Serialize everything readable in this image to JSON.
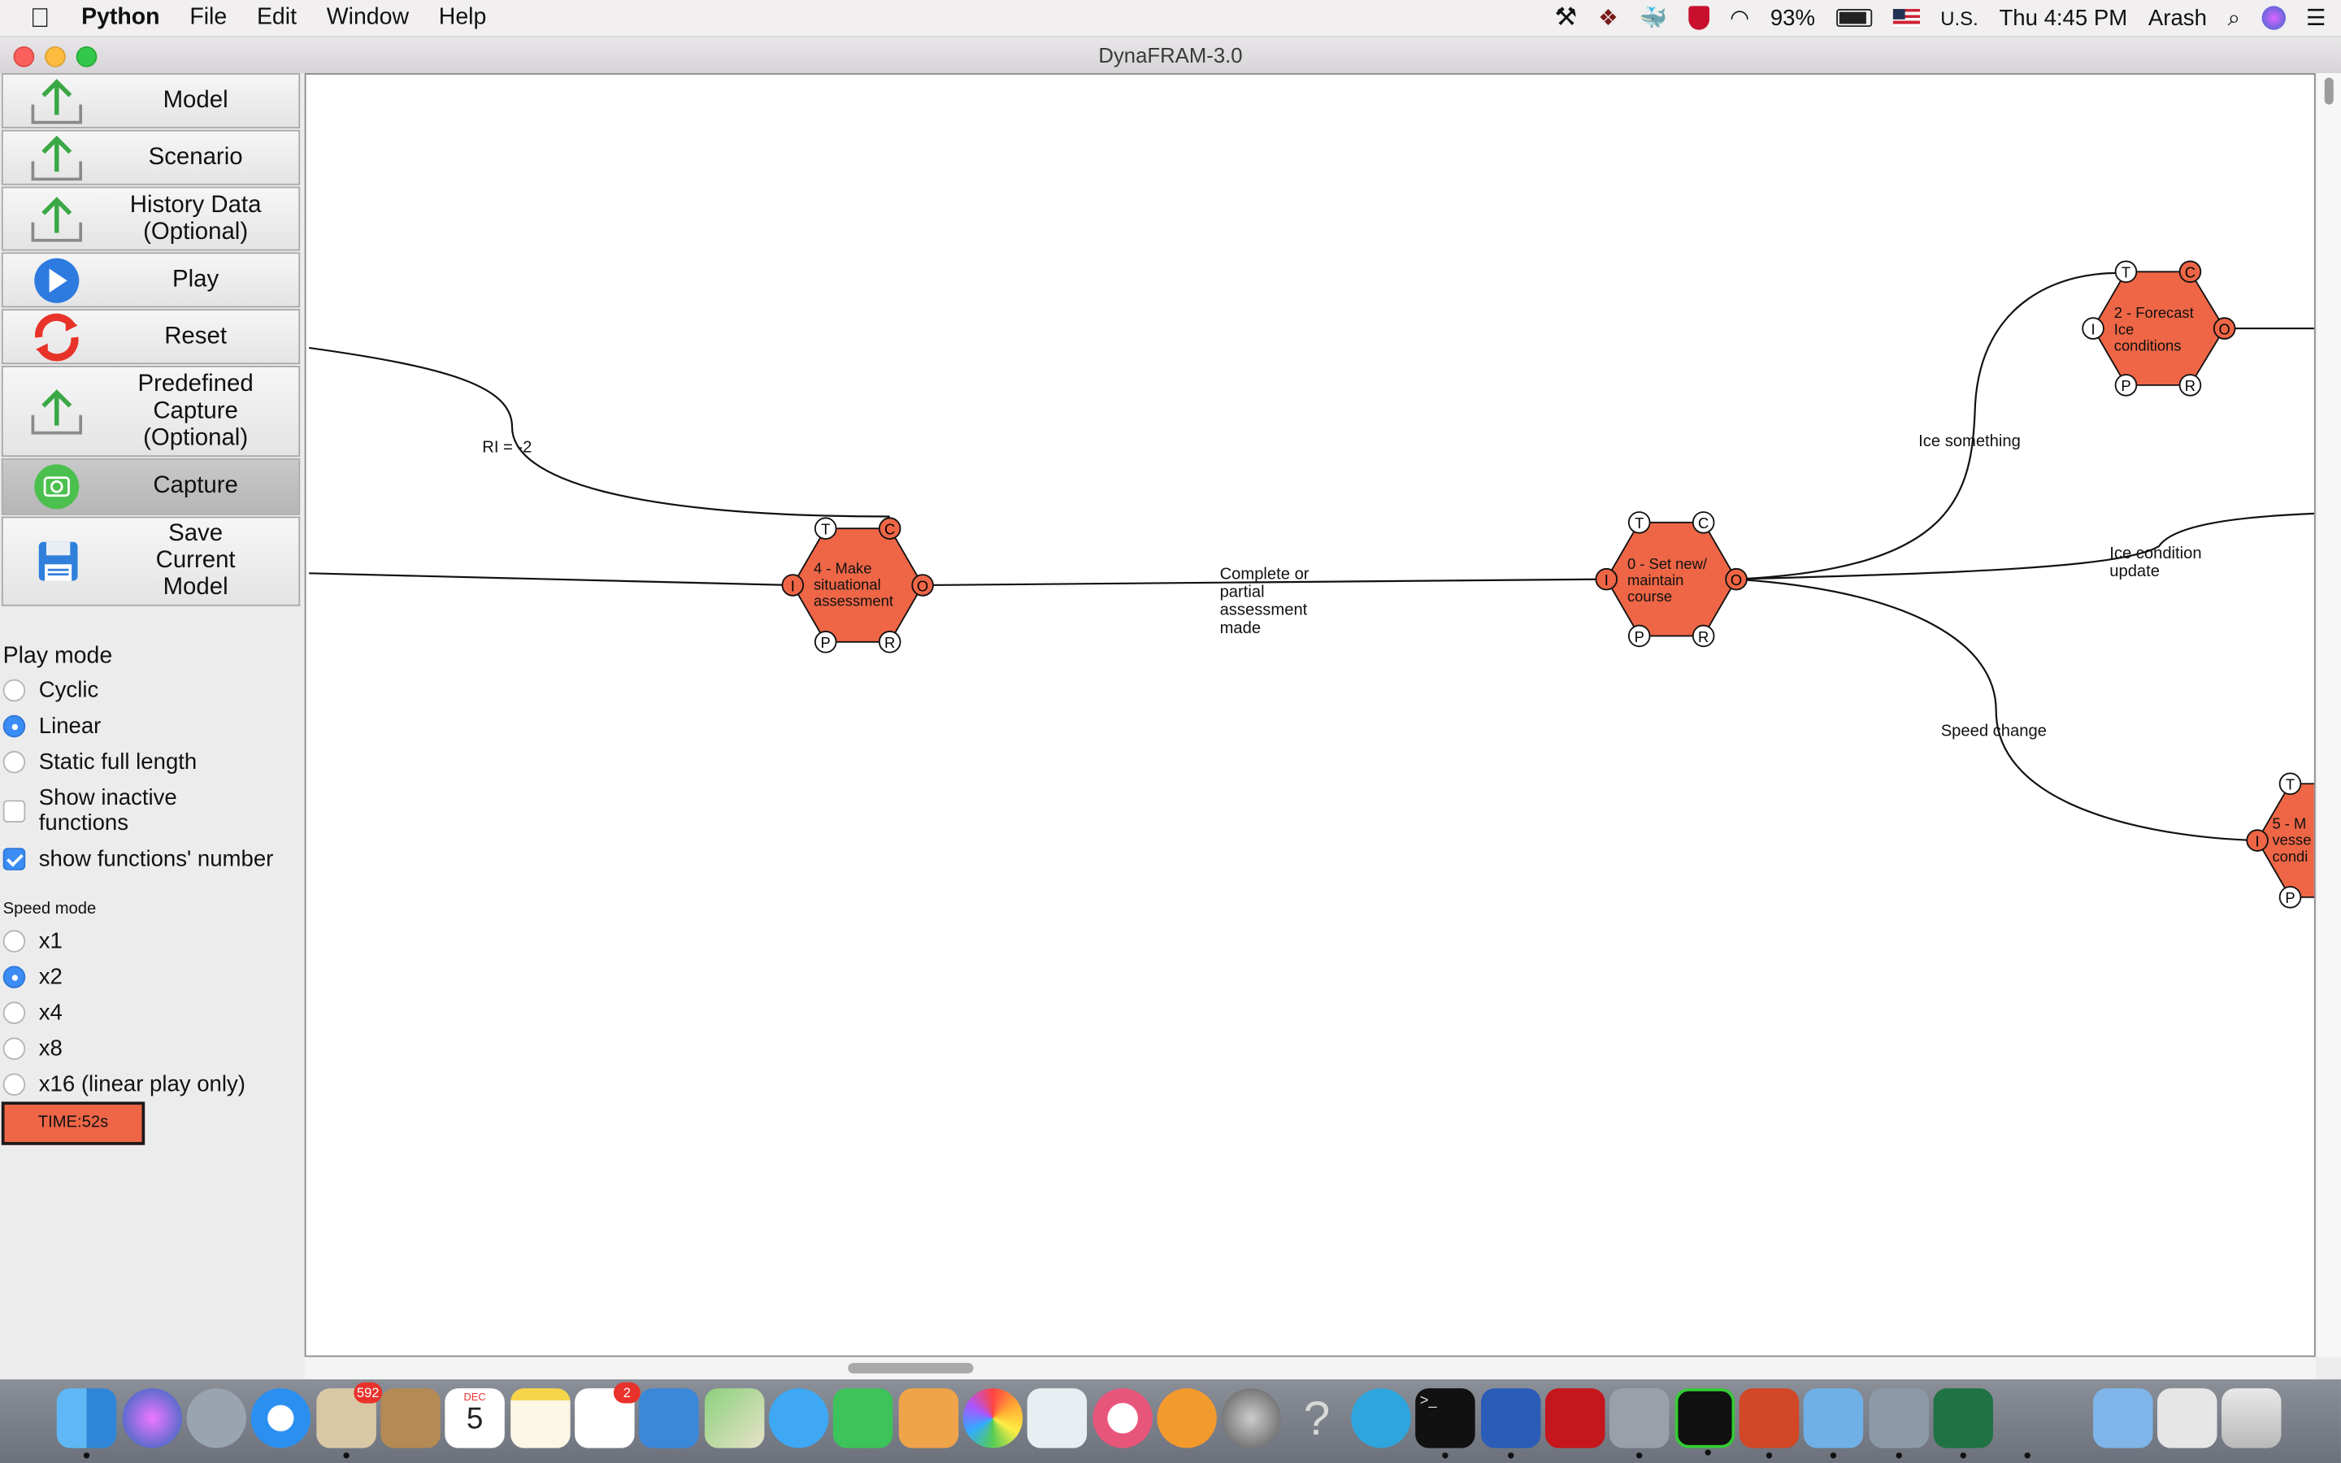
{
  "menubar": {
    "app": "Python",
    "items": [
      "File",
      "Edit",
      "Window",
      "Help"
    ],
    "battery": "93%",
    "input_source": "U.S.",
    "clock": "Thu 4:45 PM",
    "user": "Arash"
  },
  "window": {
    "title": "DynaFRAM-3.0"
  },
  "sidebar": {
    "buttons": [
      {
        "label": "Model",
        "icon": "upload-icon"
      },
      {
        "label": "Scenario",
        "icon": "upload-icon"
      },
      {
        "label": "History Data (Optional)",
        "icon": "upload-icon"
      },
      {
        "label": "Play",
        "icon": "play-icon"
      },
      {
        "label": "Reset",
        "icon": "reset-icon"
      },
      {
        "label": "Predefined Capture (Optional)",
        "icon": "upload-icon"
      },
      {
        "label": "Capture",
        "icon": "camera-icon"
      },
      {
        "label": "Save Current Model",
        "icon": "floppy-icon"
      }
    ],
    "play_mode": {
      "title": "Play mode",
      "options": [
        "Cyclic",
        "Linear",
        "Static full length"
      ],
      "selected": "Linear",
      "show_inactive": "Show inactive functions",
      "show_inactive_checked": false,
      "show_numbers": "show functions' number",
      "show_numbers_checked": true
    },
    "speed_mode": {
      "title": "Speed mode",
      "options": [
        "x1",
        "x2",
        "x4",
        "x8",
        "x16 (linear play only)"
      ],
      "selected": "x2"
    },
    "time": "TIME:52s"
  },
  "model": {
    "node_color": "#ee6646",
    "functions": [
      {
        "id": "f4",
        "label_lines": [
          "4 - Make",
          "situational",
          "assessment"
        ]
      },
      {
        "id": "f0",
        "label_lines": [
          "0 - Set new/",
          "maintain",
          "course"
        ]
      },
      {
        "id": "f2",
        "label_lines": [
          "2 - Forecast",
          "Ice",
          "conditions"
        ]
      },
      {
        "id": "f5",
        "label_lines": [
          "5 - M",
          "vesse",
          "condi"
        ]
      }
    ],
    "aspects": {
      "T": "T",
      "C": "C",
      "I": "I",
      "O": "O",
      "P": "P",
      "R": "R"
    },
    "links": [
      {
        "label_lines": [
          "RI = -2"
        ]
      },
      {
        "label_lines": [
          "Complete or",
          "partial",
          "assessment",
          "made"
        ]
      },
      {
        "label_lines": [
          "Ice something"
        ]
      },
      {
        "label_lines": [
          "Ice condition",
          "update"
        ]
      },
      {
        "label_lines": [
          "Speed change"
        ]
      }
    ]
  },
  "dock": {
    "mail_badge": "592",
    "reminders_badge": "2",
    "calendar_month": "DEC",
    "calendar_day": "5"
  }
}
